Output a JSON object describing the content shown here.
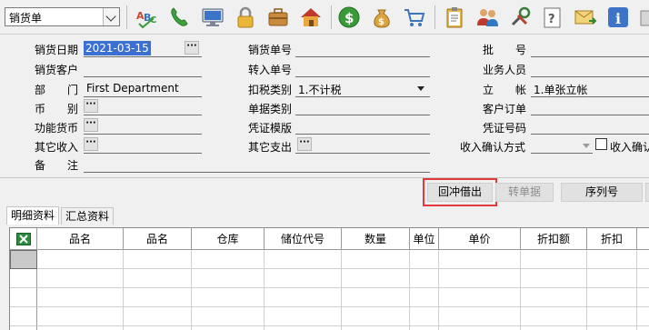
{
  "toolbar": {
    "doc_type": "销货单",
    "icons": [
      "spellcheck-icon",
      "phone-icon",
      "monitor-icon",
      "lock-icon",
      "briefcase-icon",
      "home-icon",
      "dollar-icon",
      "money-bag-icon",
      "cart-icon",
      "clipboard-icon",
      "users-icon",
      "tools-icon",
      "help-doc-icon",
      "mail-icon",
      "info-icon"
    ]
  },
  "form": {
    "sale_date_label": "销货日期",
    "sale_date_value": "2021-03-15",
    "sale_no_label": "销货单号",
    "batch_label": "批　　号",
    "customer_label": "销货客户",
    "transfer_no_label": "转入单号",
    "salesperson_label": "业务人员",
    "dept_label": "部　　门",
    "dept_value": "First Department",
    "tax_type_label": "扣税类别",
    "tax_type_value": "1.不计税",
    "account_label": "立　　帐",
    "account_value": "1.单张立帐",
    "currency_label": "币　　别",
    "bill_type_label": "单据类别",
    "cust_order_label": "客户订单",
    "func_currency_label": "功能货币",
    "voucher_tpl_label": "凭证模版",
    "voucher_no_label": "凭证号码",
    "other_income_label": "其它收入",
    "other_expense_label": "其它支出",
    "income_confirm_label": "收入确认方式",
    "income_confirm_check_label": "收入确认",
    "remark_label": "备　　注"
  },
  "actions": {
    "offset_borrow": "回冲借出",
    "transfer_doc": "转单据",
    "serial_no": "序列号"
  },
  "tabs": {
    "detail": "明细资料",
    "summary": "汇总资料"
  },
  "grid": {
    "columns": [
      "品名",
      "品名",
      "仓库",
      "储位代号",
      "数量",
      "单位",
      "单价",
      "折扣额",
      "折扣"
    ]
  }
}
